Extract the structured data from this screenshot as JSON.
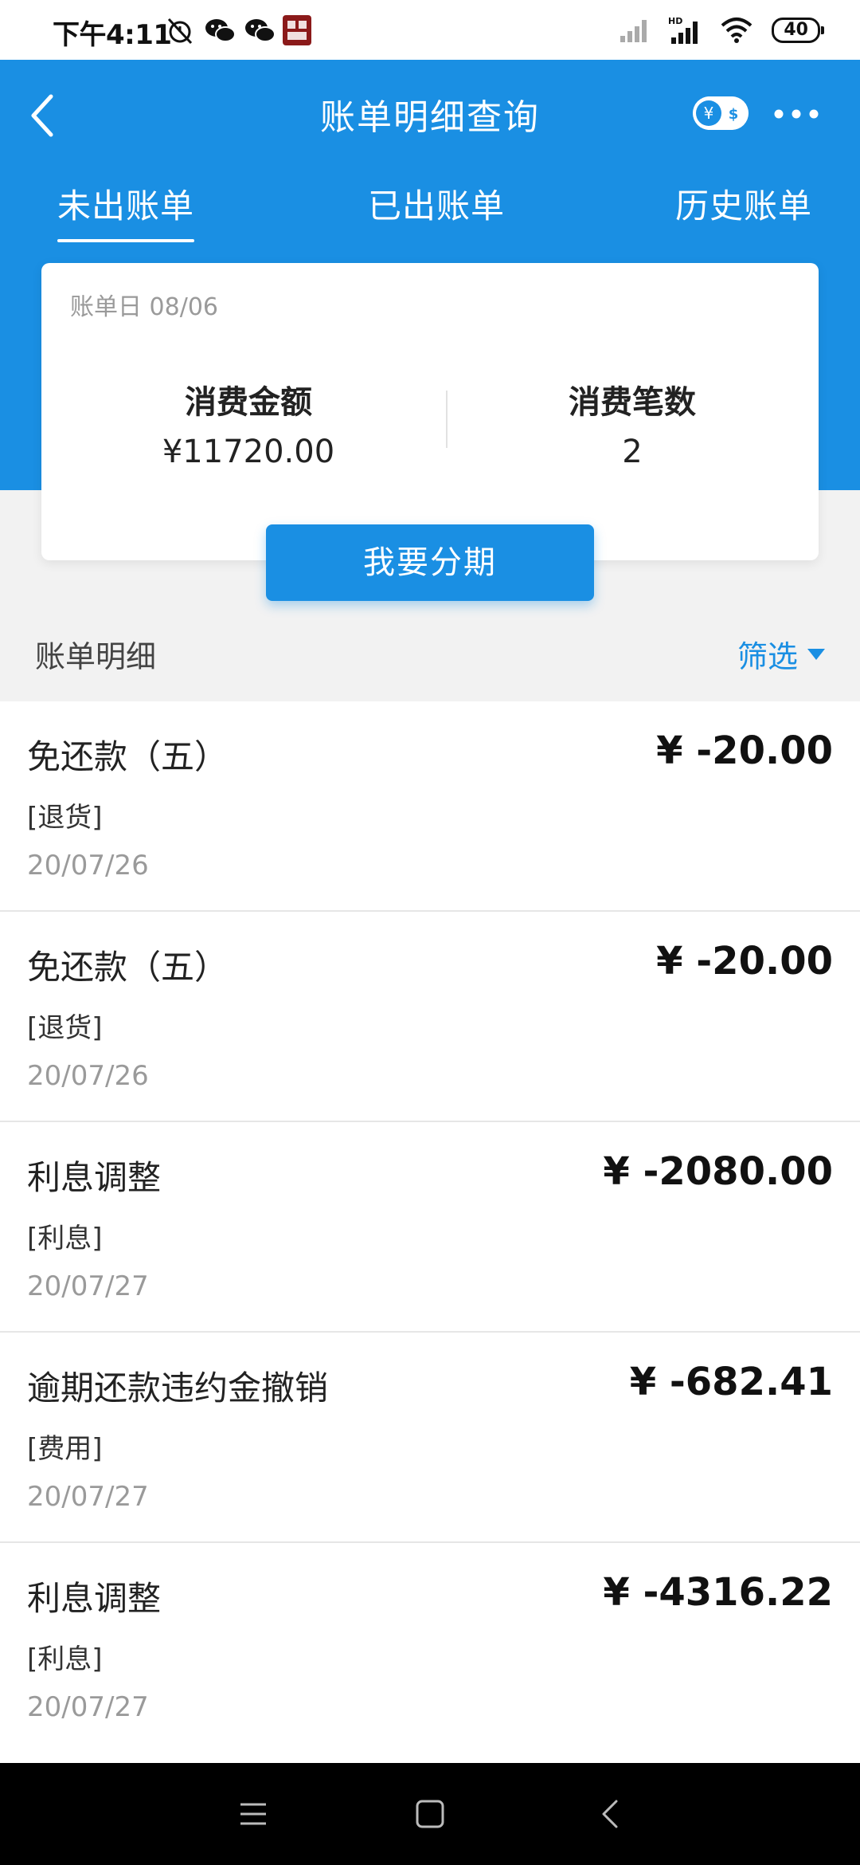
{
  "status_bar": {
    "time": "下午4:11",
    "icons": [
      "alarm-off-icon",
      "wechat-icon",
      "wechat-icon",
      "app-badge-icon",
      "signal-icon",
      "signal-hd-icon",
      "wifi-icon"
    ],
    "battery": "40"
  },
  "header": {
    "title": "账单明细查询",
    "currency_toggle_icon": "yuan-dollar-toggle-icon",
    "more_icon": "more-dots-icon"
  },
  "tabs": [
    {
      "label": "未出账单",
      "active": true
    },
    {
      "label": "已出账单",
      "active": false
    },
    {
      "label": "历史账单",
      "active": false
    }
  ],
  "summary": {
    "bill_date": "账单日 08/06",
    "amount_label": "消费金额",
    "amount_value": "¥11720.00",
    "count_label": "消费笔数",
    "count_value": "2",
    "installment_button": "我要分期"
  },
  "details": {
    "title": "账单明细",
    "filter_label": "筛选"
  },
  "transactions": [
    {
      "title": "免还款（五）",
      "tag": "[退货]",
      "date": "20/07/26",
      "amount": "¥ -20.00"
    },
    {
      "title": "免还款（五）",
      "tag": "[退货]",
      "date": "20/07/26",
      "amount": "¥ -20.00"
    },
    {
      "title": "利息调整",
      "tag": "[利息]",
      "date": "20/07/27",
      "amount": "¥ -2080.00"
    },
    {
      "title": "逾期还款违约金撤销",
      "tag": "[费用]",
      "date": "20/07/27",
      "amount": "¥ -682.41"
    },
    {
      "title": "利息调整",
      "tag": "[利息]",
      "date": "20/07/27",
      "amount": "¥ -4316.22"
    }
  ],
  "colors": {
    "primary": "#1a8fe3",
    "background": "#f2f2f2",
    "navbar": "#000000"
  }
}
